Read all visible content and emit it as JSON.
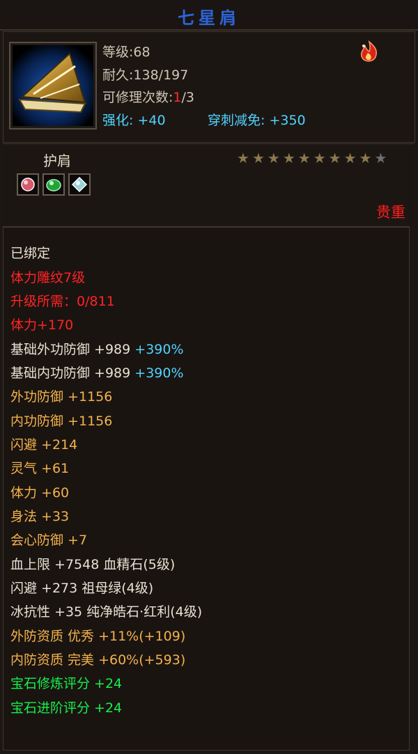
{
  "item": {
    "title": "七星肩",
    "level_text": "等级:68",
    "durability_text": "耐久:138/197",
    "repair_prefix": "可修理次数:",
    "repair_current": "1",
    "repair_suffix": "/3",
    "enhance_text": "强化: +40",
    "pierce_text": "穿刺减免: +350",
    "slot": "护肩",
    "rarity": "贵重",
    "stars": {
      "filled": 9,
      "total": 10
    },
    "gems": [
      "red-gem-icon",
      "green-gem-icon",
      "white-gem-icon"
    ]
  },
  "colors": {
    "title": "#2f64d8",
    "cyan": "#4fd4ff",
    "red": "#ff2424",
    "orange": "#f3b24b",
    "green": "#16f04b",
    "white": "#e8e2d4"
  },
  "props": [
    {
      "text": "已绑定",
      "color": "white"
    },
    {
      "text": "体力雕纹7级",
      "color": "red"
    },
    {
      "text": "升级所需：0/811",
      "color": "red"
    },
    {
      "text": "体力+170",
      "color": "red"
    },
    {
      "text": "基础外功防御 +989",
      "color": "white",
      "extra": "+390%",
      "extra_color": "cyan"
    },
    {
      "text": "基础内功防御 +989",
      "color": "white",
      "extra": "+390%",
      "extra_color": "cyan"
    },
    {
      "text": "外功防御 +1156",
      "color": "orange"
    },
    {
      "text": "内功防御 +1156",
      "color": "orange"
    },
    {
      "text": "闪避 +214",
      "color": "orange"
    },
    {
      "text": "灵气 +61",
      "color": "orange"
    },
    {
      "text": "体力 +60",
      "color": "orange"
    },
    {
      "text": "身法 +33",
      "color": "orange"
    },
    {
      "text": "会心防御 +7",
      "color": "orange"
    },
    {
      "text": "血上限 +7548 血精石(5级)",
      "color": "white"
    },
    {
      "text": "闪避 +273 祖母绿(4级)",
      "color": "white"
    },
    {
      "text": "冰抗性 +35 纯净皓石·红利(4级)",
      "color": "white"
    },
    {
      "text": "外防资质  优秀 +11%(+109)",
      "color": "orange"
    },
    {
      "text": "内防资质  完美 +60%(+593)",
      "color": "orange"
    },
    {
      "text": "宝石修炼评分 +24",
      "color": "green"
    },
    {
      "text": "宝石进阶评分 +24",
      "color": "green"
    }
  ]
}
